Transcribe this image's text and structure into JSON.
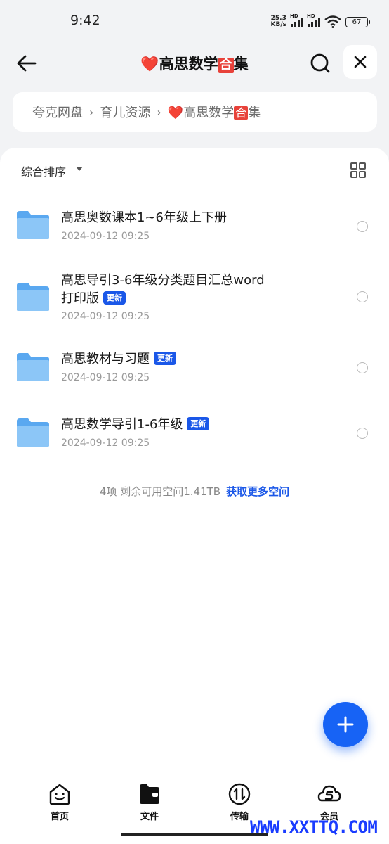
{
  "status": {
    "time": "9:42",
    "net_speed_value": "25.3",
    "net_speed_unit": "KB/s",
    "signal_label": "HD",
    "battery": "67"
  },
  "nav": {
    "title_heart": "❤️",
    "title_a": "高思数学",
    "title_he": "合",
    "title_b": "集"
  },
  "breadcrumb": {
    "items": [
      "夸克网盘",
      "育儿资源"
    ],
    "current_heart": "❤️",
    "current_a": "高思数学",
    "current_he": "合",
    "current_b": "集"
  },
  "toolbar": {
    "sort_label": "综合排序"
  },
  "files": [
    {
      "name": "高思奥数课本1~6年级上下册",
      "badge": "",
      "date": "2024-09-12 09:25"
    },
    {
      "name_line1": "高思导引3-6年级分类题目汇总word",
      "name_line2": "打印版",
      "badge": "更新",
      "date": "2024-09-12 09:25"
    },
    {
      "name": "高思教材与习题",
      "badge": "更新",
      "date": "2024-09-12 09:25"
    },
    {
      "name": "高思数学导引1-6年级",
      "badge": "更新",
      "date": "2024-09-12 09:25"
    }
  ],
  "summary": {
    "text": "4项 剩余可用空间1.41TB",
    "link": "获取更多空间"
  },
  "tabs": [
    {
      "label": "首页",
      "icon": "home-face-icon"
    },
    {
      "label": "文件",
      "icon": "folder-file-icon"
    },
    {
      "label": "传输",
      "icon": "transfer-icon"
    },
    {
      "label": "会员",
      "icon": "vip-s-icon"
    }
  ],
  "watermark": "WWW.XXTTQ.COM",
  "colors": {
    "accent": "#1a57e8",
    "fab": "#1763f5",
    "folder": "#5aa8f0",
    "he_bg": "#e8423a"
  }
}
